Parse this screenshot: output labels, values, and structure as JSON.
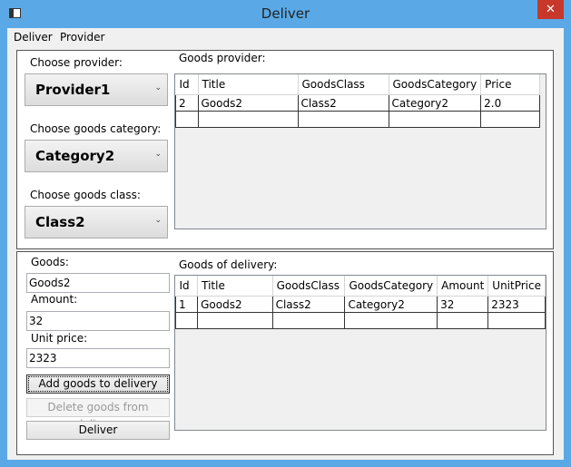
{
  "window": {
    "title": "Deliver",
    "close_glyph": "✕",
    "app_icon": "window-icon",
    "close_icon": "close-icon"
  },
  "menu": {
    "items": [
      "Deliver",
      "Provider"
    ]
  },
  "top": {
    "provider_label": "Choose provider:",
    "provider_value": "Provider1",
    "category_label": "Choose goods category:",
    "category_value": "Category2",
    "class_label": "Choose goods class:",
    "class_value": "Class2",
    "arrow": "⌄",
    "grid_title": "Goods provider:",
    "grid_headers": [
      "Id",
      "Title",
      "GoodsClass",
      "GoodsCategory",
      "Price"
    ],
    "grid_rows": [
      [
        "2",
        "Goods2",
        "Class2",
        "Category2",
        "2.0"
      ]
    ]
  },
  "bottom": {
    "goods_label": "Goods:",
    "goods_value": "Goods2",
    "amount_label": "Amount:",
    "amount_value": "32",
    "unit_price_label": "Unit price:",
    "unit_price_value": "2323",
    "add_button": "Add goods to delivery",
    "delete_button": "Delete goods from delivery",
    "deliver_button": "Deliver",
    "grid_title": "Goods of delivery:",
    "grid_headers": [
      "Id",
      "Title",
      "GoodsClass",
      "GoodsCategory",
      "Amount",
      "UnitPrice"
    ],
    "grid_rows": [
      [
        "1",
        "Goods2",
        "Class2",
        "Category2",
        "32",
        "2323"
      ]
    ]
  },
  "colors": {
    "title_bar": "#5aa9e6",
    "close_button": "#c7372a"
  }
}
